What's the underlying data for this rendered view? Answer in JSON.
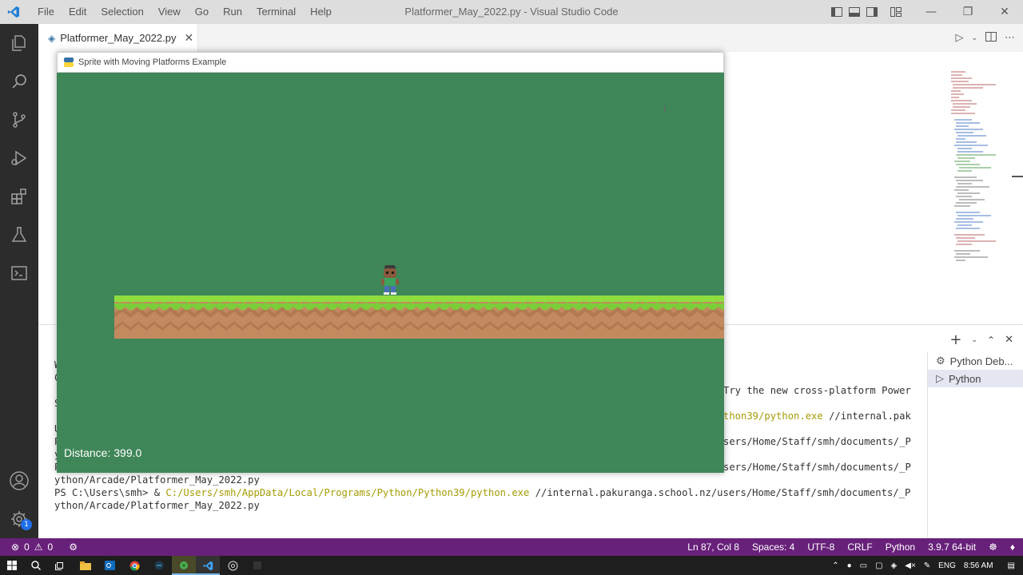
{
  "window": {
    "title": "Platformer_May_2022.py - Visual Studio Code",
    "menu": [
      "File",
      "Edit",
      "Selection",
      "View",
      "Go",
      "Run",
      "Terminal",
      "Help"
    ]
  },
  "editor": {
    "tab_label": "Platformer_May_2022.py"
  },
  "game_window": {
    "title": "Sprite with Moving Platforms Example",
    "hud_text": "Distance: 399.0",
    "background_color": "#3f8658"
  },
  "panel": {
    "terminals": [
      {
        "label": "Python Deb...",
        "icon": "gear-icon"
      },
      {
        "label": "Python",
        "icon": "terminal-icon"
      }
    ],
    "lines": [
      {
        "text": "W"
      },
      {
        "text": "C"
      },
      {
        "text": "S",
        "tail": "Try the new cross-platform Power"
      },
      {
        "text": "U",
        "tail_path": "thon39/python.exe",
        "tail": " //internal.pak"
      },
      {
        "text": "P",
        "tail": "sers/Home/Staff/smh/documents/_P"
      },
      {
        "text": "y"
      },
      {
        "text": "P",
        "tail": "sers/Home/Staff/smh/documents/_P"
      },
      {
        "text": "ython/Arcade/Platformer_May_2022.py"
      },
      {
        "prompt": "PS C:\\Users\\smh> & ",
        "path": "C:/Users/smh/AppData/Local/Programs/Python/Python39/python.exe",
        "rest": " //internal.pakuranga.school.nz/users/Home/Staff/smh/documents/_P"
      },
      {
        "text": "ython/Arcade/Platformer_May_2022.py"
      }
    ]
  },
  "statusbar": {
    "errors": "0",
    "warnings": "0",
    "position": "Ln 87, Col 8",
    "spaces": "Spaces: 4",
    "encoding": "UTF-8",
    "eol": "CRLF",
    "language": "Python",
    "interpreter": "3.9.7 64-bit"
  },
  "taskbar": {
    "language": "ENG",
    "time": "8:56 AM"
  },
  "activity": {
    "badge": "1"
  }
}
